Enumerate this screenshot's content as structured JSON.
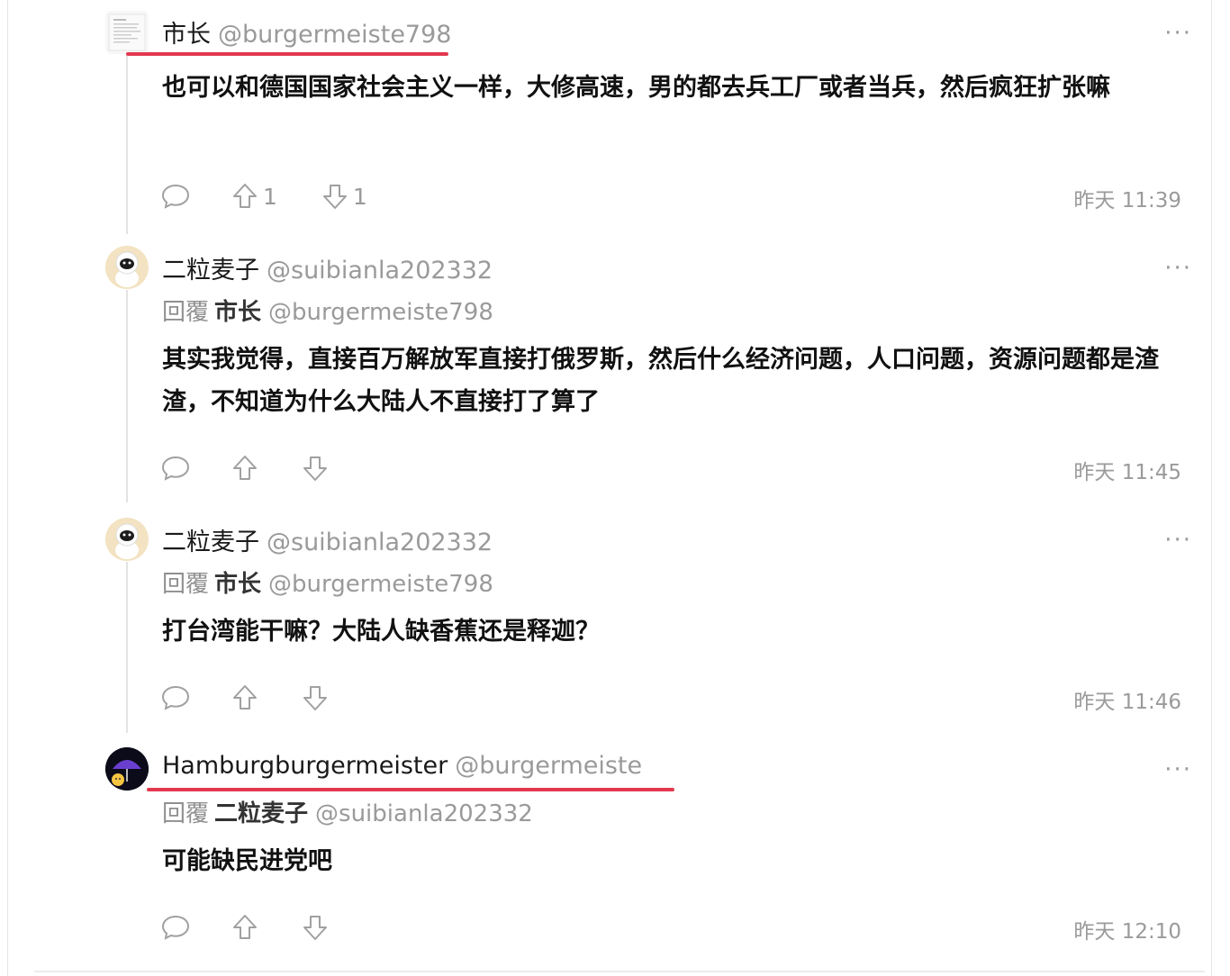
{
  "comments": [
    {
      "name": "市长",
      "handle": "@burgermeiste798",
      "text": "也可以和德国国家社会主义一样，大修高速，男的都去兵工厂或者当兵，然后疯狂扩张嘛",
      "upvotes": "1",
      "downvotes": "1",
      "time": "昨天 11:39",
      "more": "···"
    },
    {
      "name": "二粒麦子",
      "handle": "@suibianla202332",
      "reply_prefix": "回覆",
      "reply_name": "市长",
      "reply_handle": "@burgermeiste798",
      "text": "其实我觉得，直接百万解放军直接打俄罗斯，然后什么经济问题，人口问题，资源问题都是渣渣，不知道为什么大陆人不直接打了算了",
      "time": "昨天 11:45",
      "more": "···"
    },
    {
      "name": "二粒麦子",
      "handle": "@suibianla202332",
      "reply_prefix": "回覆",
      "reply_name": "市长",
      "reply_handle": "@burgermeiste798",
      "text": "打台湾能干嘛？大陆人缺香蕉还是释迦？",
      "time": "昨天 11:46",
      "more": "···"
    },
    {
      "name": "Hamburgburgermeister",
      "handle": "@burgermeiste",
      "reply_prefix": "回覆",
      "reply_name": "二粒麦子",
      "reply_handle": "@suibianla202332",
      "text": "可能缺民进党吧",
      "time": "昨天 12:10",
      "more": "···"
    }
  ],
  "icons": {
    "reply": "comment-bubble-icon",
    "upvote": "arrow-up-icon",
    "downvote": "arrow-down-icon",
    "more": "more-dots-icon"
  },
  "colors": {
    "highlight_underline": "#e2384f",
    "muted_text": "#9a9a9a"
  }
}
